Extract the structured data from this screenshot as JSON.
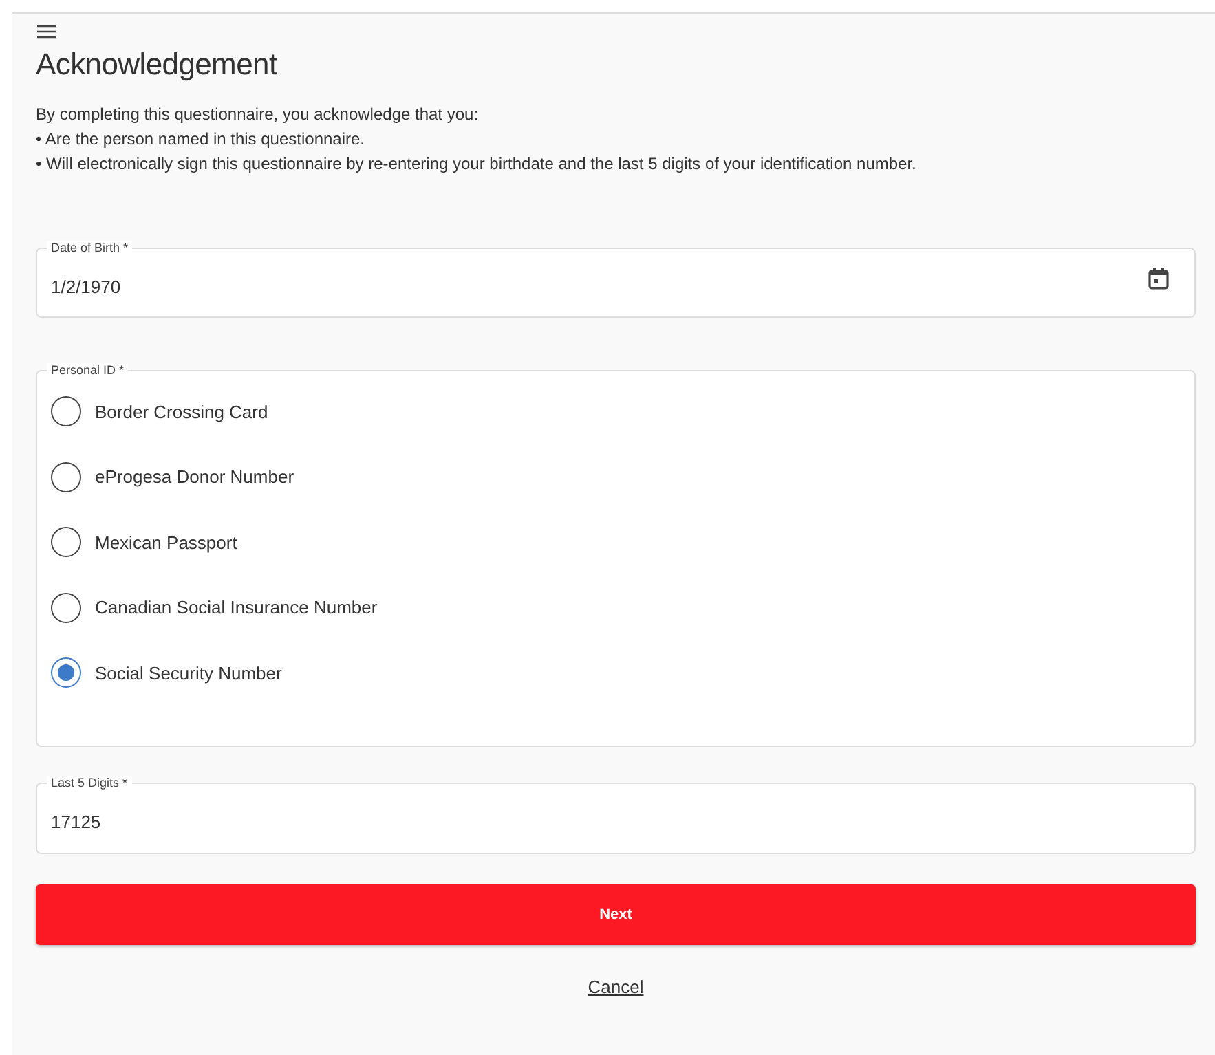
{
  "title": "Acknowledgement",
  "intro": "By completing this questionnaire, you acknowledge that you:",
  "bullets": [
    "• Are the person named in this questionnaire.",
    "• Will electronically sign this questionnaire by re-entering your birthdate and the last 5 digits of your identification number."
  ],
  "date_of_birth": {
    "label": "Date of Birth *",
    "value": "1/2/1970"
  },
  "personal_id": {
    "label": "Personal ID *",
    "options": [
      {
        "label": "Border Crossing Card",
        "selected": false
      },
      {
        "label": "eProgesa Donor Number",
        "selected": false
      },
      {
        "label": "Mexican Passport",
        "selected": false
      },
      {
        "label": "Canadian Social Insurance Number",
        "selected": false
      },
      {
        "label": "Social Security Number",
        "selected": true
      }
    ]
  },
  "last_digits": {
    "label": "Last 5 Digits *",
    "value": "17125"
  },
  "next_button": "Next",
  "cancel_link": "Cancel"
}
